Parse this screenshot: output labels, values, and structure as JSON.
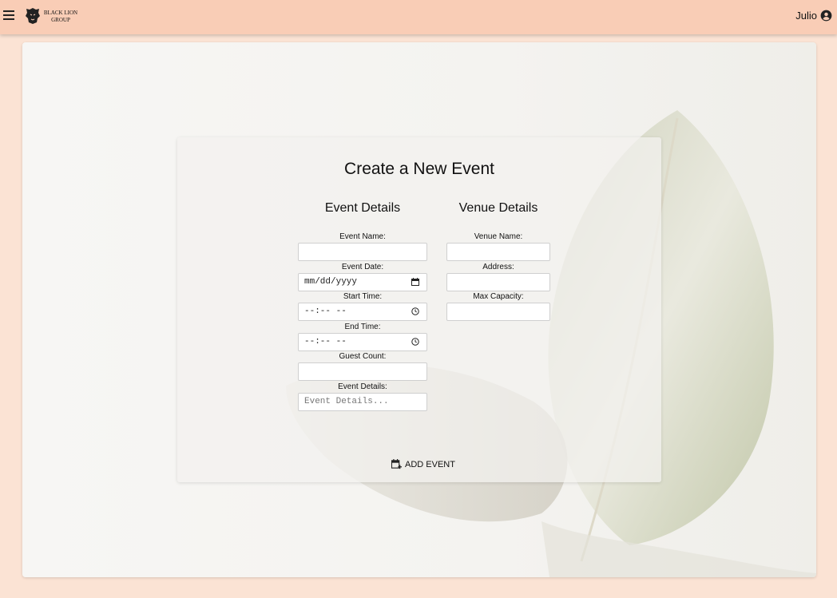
{
  "header": {
    "logo_line1": "BLACK LION",
    "logo_line2": "GROUP",
    "user_name": "Julio"
  },
  "form": {
    "title": "Create a New Event",
    "event_section": {
      "heading": "Event Details",
      "event_name_label": "Event Name:",
      "event_name_value": "",
      "event_date_label": "Event Date:",
      "event_date_placeholder": "mm/dd/yyyy",
      "start_time_label": "Start Time:",
      "start_time_placeholder": "--:-- --",
      "end_time_label": "End Time:",
      "end_time_placeholder": "--:-- --",
      "guest_count_label": "Guest Count:",
      "guest_count_value": "",
      "details_label": "Event Details:",
      "details_placeholder": "Event Details..."
    },
    "venue_section": {
      "heading": "Venue Details",
      "venue_name_label": "Venue Name:",
      "venue_name_value": "",
      "address_label": "Address:",
      "address_value": "",
      "capacity_label": "Max Capacity:",
      "capacity_value": ""
    },
    "add_button_label": "ADD EVENT"
  },
  "icons": {
    "menu": "menu-icon",
    "user": "account-circle-icon",
    "calendar": "calendar-icon",
    "clock": "clock-icon",
    "add_event": "calendar-plus-icon"
  },
  "colors": {
    "topbar": "#f9cdb6",
    "page_background": "#fbe3d4",
    "card": "#f5f4f1"
  }
}
